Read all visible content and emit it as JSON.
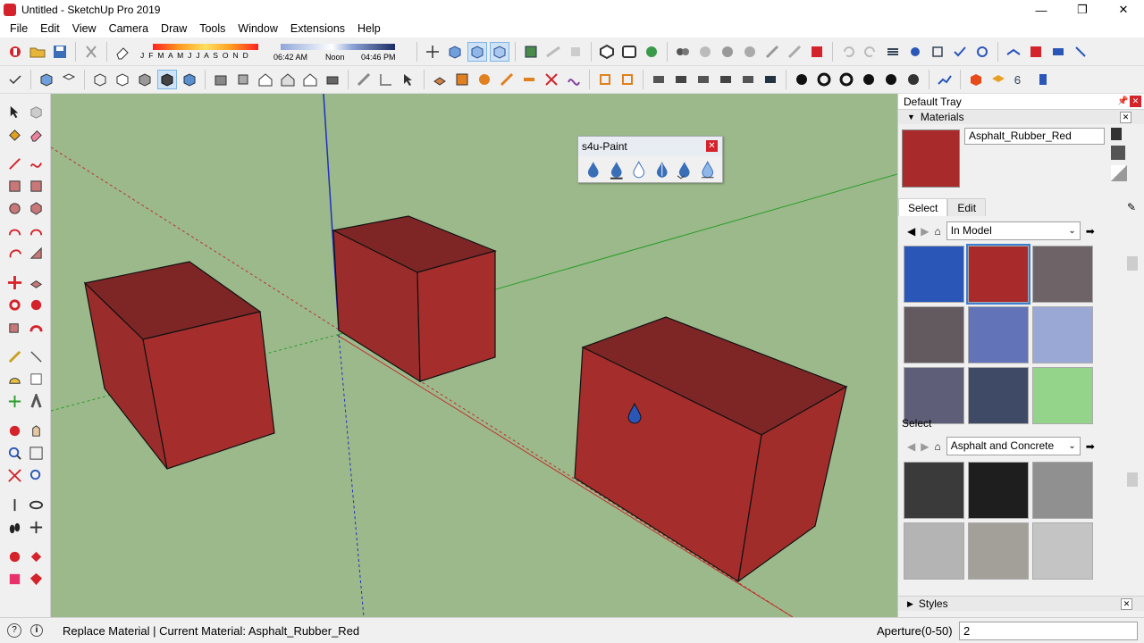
{
  "window": {
    "title": "Untitled - SketchUp Pro 2019",
    "min": "—",
    "max": "❐",
    "close": "✕"
  },
  "menu": [
    "File",
    "Edit",
    "View",
    "Camera",
    "Draw",
    "Tools",
    "Window",
    "Extensions",
    "Help"
  ],
  "shadows": {
    "months": "J F M A M J J A S O N D",
    "time_start": "06:42 AM",
    "time_mid": "Noon",
    "time_end": "04:46 PM"
  },
  "s4u_paint": {
    "title": "s4u-Paint",
    "close": "✕"
  },
  "tray": {
    "title": "Default Tray",
    "materials_panel": "Materials",
    "material_name": "Asphalt_Rubber_Red",
    "tab_select": "Select",
    "tab_edit": "Edit",
    "collection": "In Model",
    "swatches": [
      "#2a56b8",
      "#a82a2a",
      "#6e6467",
      "#625a5e",
      "#6273b8",
      "#9aa8d6",
      "#5e5e78",
      "#3f4a66",
      "#94d38a"
    ],
    "selected_swatch": 1,
    "select_label": "Select",
    "collection2": "Asphalt and Concrete",
    "swatches2": [
      "#3a3a3a",
      "#1e1e1e",
      "#909090",
      "#b4b4b4",
      "#a3a09a",
      "#c4c4c4"
    ],
    "styles_panel": "Styles"
  },
  "status": {
    "message": "Replace Material | Current Material: Asphalt_Rubber_Red",
    "aperture_label": "Aperture(0-50)",
    "aperture_value": "2"
  },
  "colors": {
    "viewport": "#9bb98a",
    "box_red": "#a52e2c",
    "box_top": "#7e2626",
    "axis_red": "#c03030",
    "axis_green": "#2a9d2a",
    "axis_blue": "#2030c0"
  }
}
